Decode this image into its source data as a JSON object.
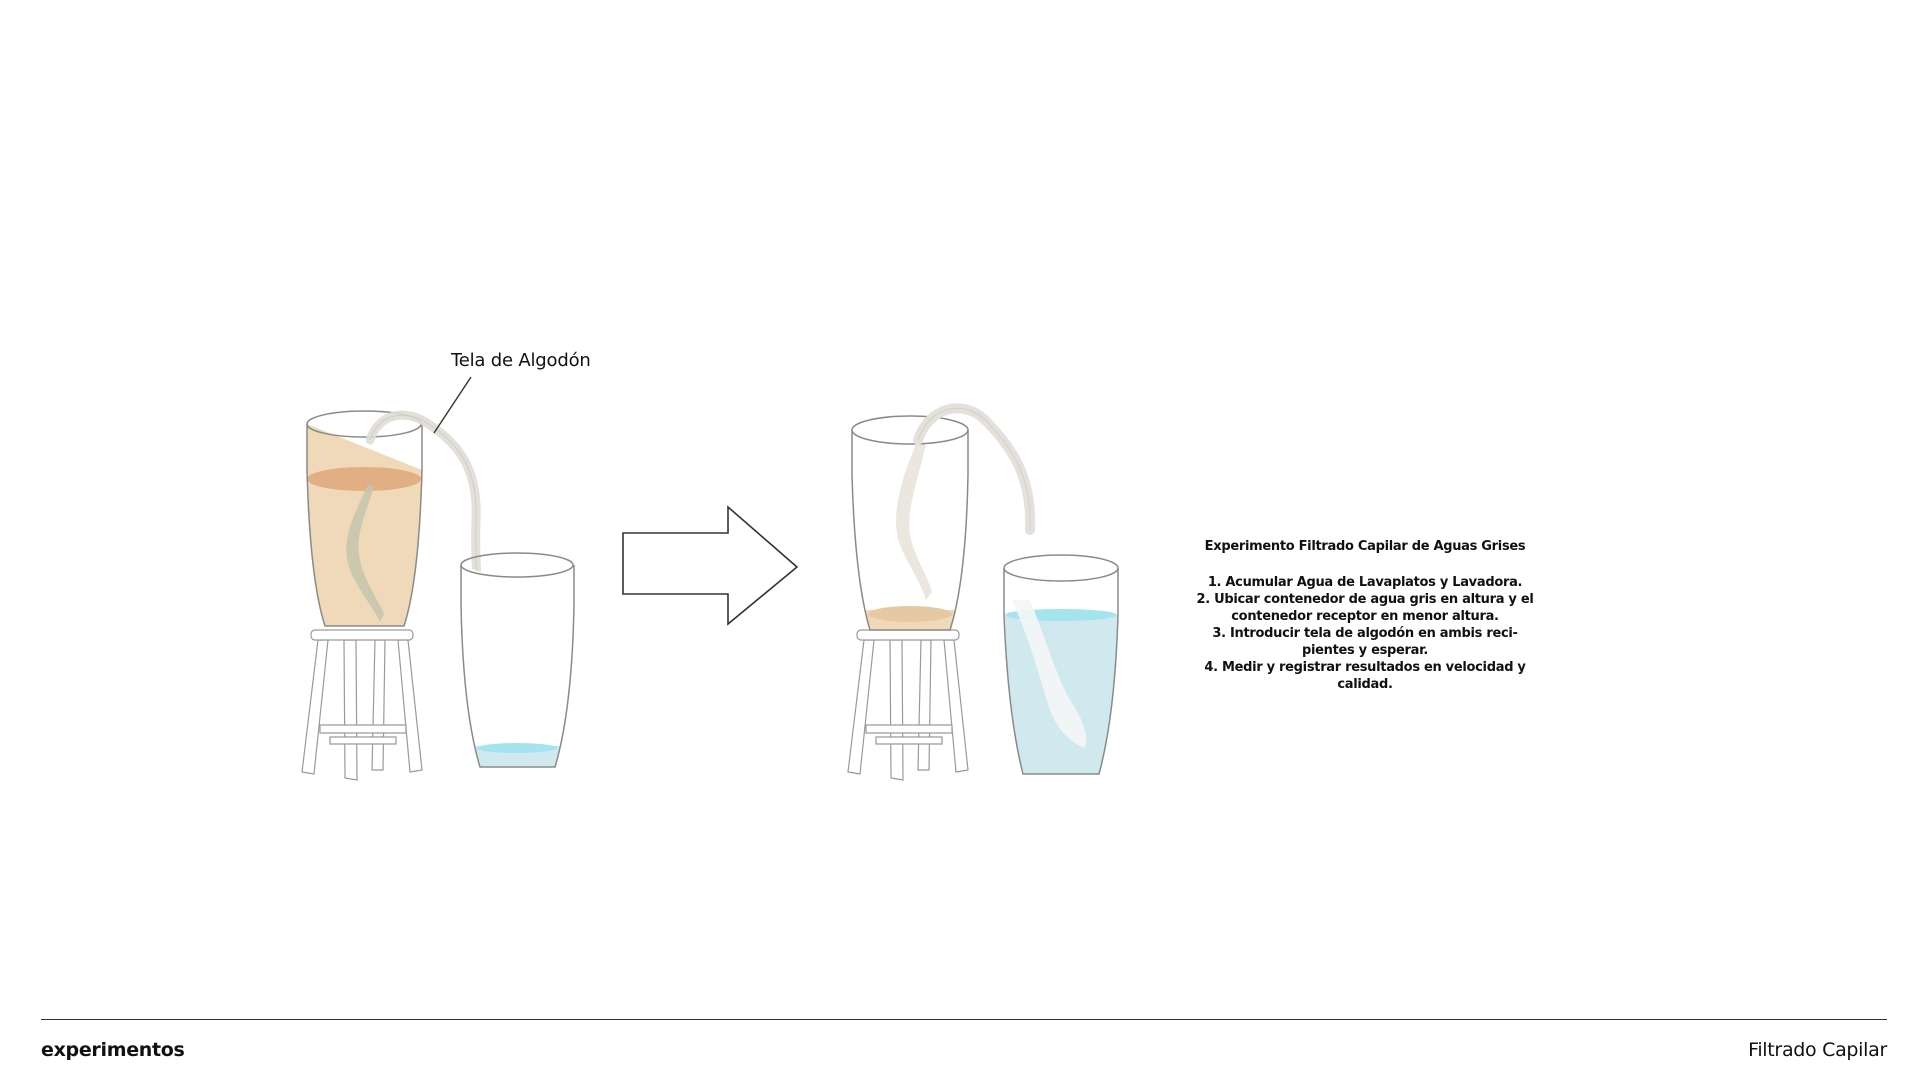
{
  "diagram": {
    "callout_label": "Tela de Algodón",
    "colors": {
      "glass_outline": "#8a8a8a",
      "greywater_fill": "#efd9b8",
      "greywater_surface": "#e2ae84",
      "cloth_wet": "#c6c3ad",
      "cloth_dry": "#ebe7df",
      "clean_water_fill": "#cfe9ef",
      "clean_water_surface": "#a5e3ef",
      "stool_outline": "#9a9a9a",
      "arrow_outline": "#333333"
    }
  },
  "instructions": {
    "title": "Experimento Filtrado Capilar de Aguas Grises",
    "steps": [
      "1. Acumular Agua de Lavaplatos y Lavadora.",
      "2. Ubicar contenedor de agua gris en altura y el contenedor receptor en menor altura.",
      "3. Introducir tela de algodón en ambis reci- pientes y esperar.",
      "4. Medir y registrar resultados en velocidad y calidad."
    ]
  },
  "footer": {
    "left": "experimentos",
    "right": "Filtrado Capilar"
  }
}
